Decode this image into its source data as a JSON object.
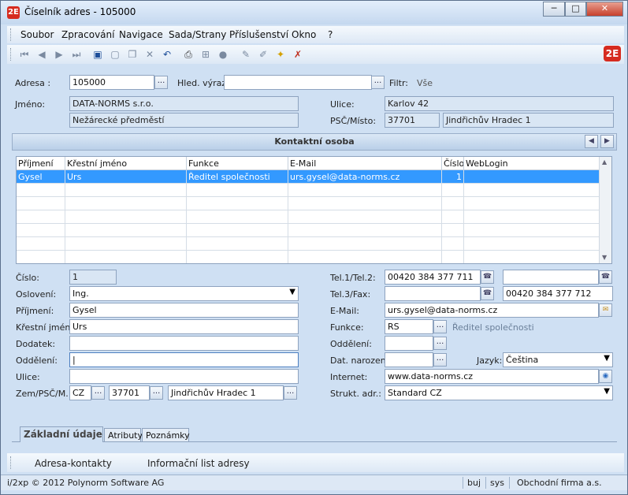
{
  "window": {
    "title": "Číselník adres - 105000",
    "app_icon": "2E",
    "min_label": "─",
    "max_label": "□",
    "close_label": "✕"
  },
  "menu": [
    "Soubor",
    "Zpracování",
    "Navigace",
    "Sada/Strany",
    "Příslušenství",
    "Okno",
    "?"
  ],
  "toolbar": {
    "icons": [
      "first-record-icon",
      "prev-record-icon",
      "next-record-icon",
      "last-record-icon",
      "save-icon",
      "new-icon",
      "copy-icon",
      "delete-icon",
      "undo-icon",
      "print-icon",
      "tree-icon",
      "stop-icon",
      "edit-icon",
      "edit-alt-icon",
      "filter-icon",
      "clear-filter-icon"
    ],
    "logo": "2E"
  },
  "header": {
    "adresa_label": "Adresa :",
    "adresa_value": "105000",
    "hled_label": "Hled. výraz:",
    "hled_value": "",
    "filtr_label": "Filtr:",
    "filtr_value": "Vše",
    "jmeno_label": "Jméno:",
    "jmeno_value": "DATA-NORMS s.r.o.",
    "jmeno_value2": "Nežárecké předměstí",
    "ulice_label": "Ulice:",
    "ulice_value": "Karlov 42",
    "psc_label": "PSČ/Místo:",
    "psc_value": "37701",
    "misto_value": "Jindřichův Hradec 1"
  },
  "panel": {
    "title": "Kontaktní osoba"
  },
  "grid": {
    "columns": [
      "Příjmení",
      "Křestní jméno",
      "Funkce",
      "E-Mail",
      "Číslo",
      "WebLogin"
    ],
    "rows": [
      [
        "Gysel",
        "Urs",
        "Ředitel společnosti",
        "urs.gysel@data-norms.cz",
        "1",
        ""
      ]
    ],
    "empty_rows": 6
  },
  "detail": {
    "cislo_label": "Číslo:",
    "cislo_value": "1",
    "osloveni_label": "Oslovení:",
    "osloveni_value": "Ing.",
    "prijmeni_label": "Příjmení:",
    "prijmeni_value": "Gysel",
    "krestni_label": "Křestní jméno:",
    "krestni_value": "Urs",
    "dodatek_label": "Dodatek:",
    "dodatek_value": "",
    "oddeleni_label": "Oddělení:",
    "oddeleni_value": "|",
    "ulice_label": "Ulice:",
    "ulice_value": "",
    "zem_label": "Zem/PSČ/M.:",
    "zem_value": "CZ",
    "zem_psc": "37701",
    "zem_misto": "Jindřichův Hradec 1",
    "tel12_label": "Tel.1/Tel.2:",
    "tel1_value": "00420 384 377 711",
    "tel2_value": "",
    "tel3_label": "Tel.3/Fax:",
    "tel3_value": "",
    "fax_value": "00420 384 377 712",
    "email_label": "E-Mail:",
    "email_value": "urs.gysel@data-norms.cz",
    "funkce_label": "Funkce:",
    "funkce_code": "RS",
    "funkce_text": "Ředitel společnosti",
    "oddeleni2_label": "Oddělení:",
    "oddeleni2_value": "",
    "dat_label": "Dat. narození:",
    "dat_value": "",
    "jazyk_label": "Jazyk:",
    "jazyk_value": "Čeština",
    "internet_label": "Internet:",
    "internet_value": "www.data-norms.cz",
    "strukt_label": "Strukt. adr.:",
    "strukt_value": "Standard CZ",
    "dots": "..."
  },
  "tabs": [
    "Základní údaje",
    "Atributy",
    "Poznámky"
  ],
  "bottom": [
    "Adresa-kontakty",
    "Informační list adresy"
  ],
  "status": {
    "copyright": "i/2xp © 2012 Polynorm Software AG",
    "lang": "buj",
    "user": "sys",
    "company": "Obchodní firma a.s."
  }
}
